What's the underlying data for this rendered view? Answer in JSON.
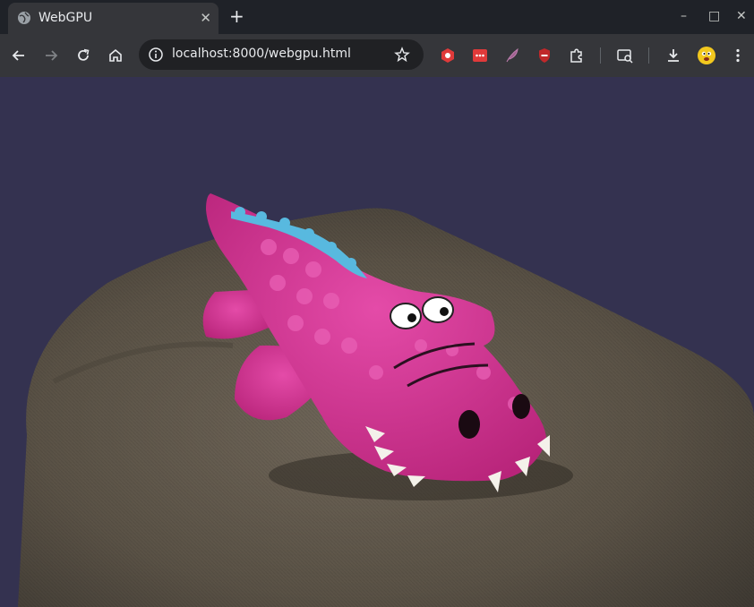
{
  "tab": {
    "title": "WebGPU",
    "close_glyph": "✕"
  },
  "new_tab_glyph": "+",
  "window_controls": {
    "minimize": "–",
    "maximize": "□",
    "close": "✕"
  },
  "address": {
    "url": "localhost:8000/webgpu.html"
  },
  "scene": {
    "background": "#343250",
    "subject": "pink-crocodile-plush",
    "surface": "gray-cloth-pillow"
  },
  "icons": [
    "back-icon",
    "forward-icon",
    "reload-icon",
    "home-icon",
    "site-info-icon",
    "bookmark-star-icon",
    "extension-icons",
    "extensions-puzzle-icon",
    "tab-search-icon",
    "downloads-icon",
    "profile-avatar-icon",
    "menu-kebab-icon"
  ]
}
